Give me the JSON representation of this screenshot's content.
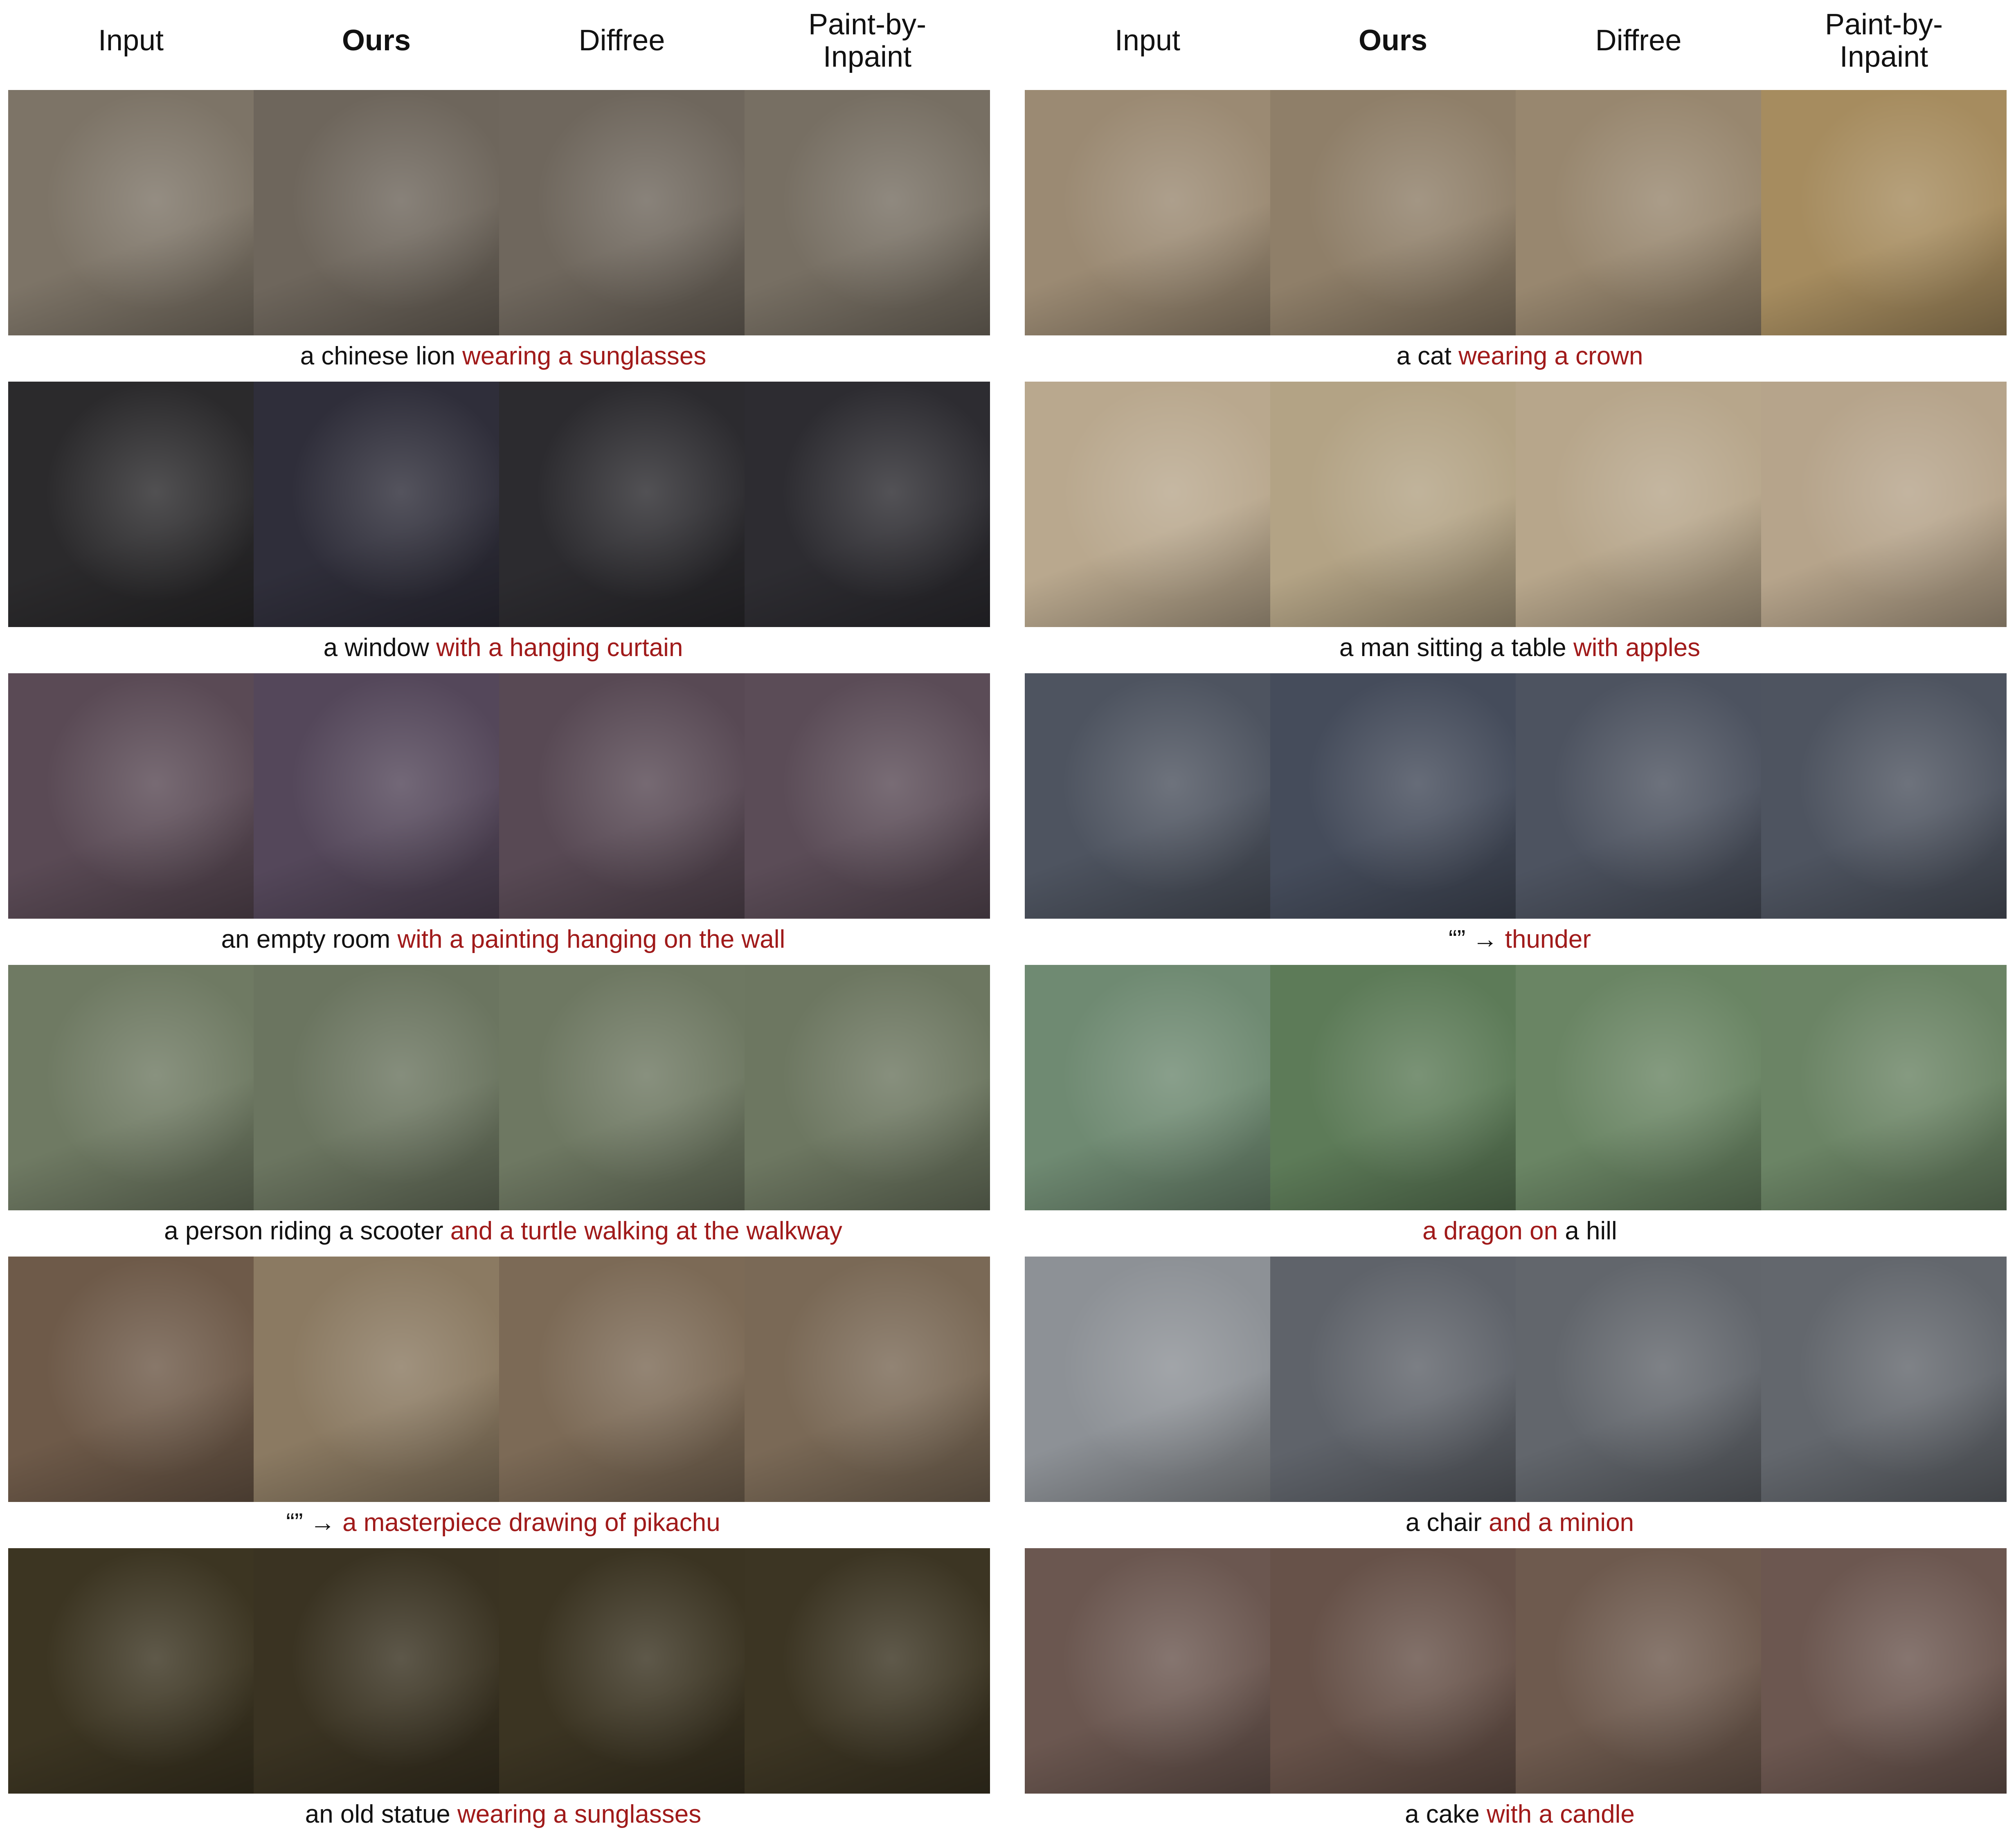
{
  "columns": {
    "left": [
      "Input",
      "Ours",
      "Diffree",
      "Paint-by-\nInpaint"
    ],
    "right": [
      "Input",
      "Ours",
      "Diffree",
      "Paint-by-\nInpaint"
    ]
  },
  "rows": [
    {
      "left": {
        "pre": "a chinese lion ",
        "hl": "wearing a sunglasses",
        "post": "",
        "colors": [
          "#7d7467",
          "#6e665c",
          "#6f675d",
          "#776f63"
        ]
      },
      "right": {
        "pre": "a cat ",
        "hl": "wearing a crown",
        "post": "",
        "colors": [
          "#9b8a73",
          "#8f7f69",
          "#98876f",
          "#a68c5f"
        ]
      }
    },
    {
      "left": {
        "pre": "a window ",
        "hl": "with a hanging curtain",
        "post": "",
        "colors": [
          "#2b2a2c",
          "#2f2e3a",
          "#2c2b2f",
          "#2d2c31"
        ]
      },
      "right": {
        "pre": "a man sitting a table ",
        "hl": "with apples",
        "post": "",
        "colors": [
          "#b9a88e",
          "#b3a385",
          "#b7a68b",
          "#b6a48b"
        ]
      }
    },
    {
      "left": {
        "pre": "an empty room ",
        "hl": "with a painting hanging on the wall",
        "post": "",
        "colors": [
          "#5a4a55",
          "#54475a",
          "#584954",
          "#5b4c57"
        ]
      },
      "right": {
        "pre": "“” → ",
        "hl": "thunder",
        "post": "",
        "colors": [
          "#4e5460",
          "#454c5b",
          "#4d5360",
          "#4e5460"
        ]
      }
    },
    {
      "left": {
        "pre": "a person riding a scooter ",
        "hl": "and a turtle walking at the walkway",
        "post": "",
        "colors": [
          "#6f7a63",
          "#6b7560",
          "#6e7862",
          "#6d7761"
        ]
      },
      "right": {
        "pre": "",
        "hl": "a dragon on",
        "post": " a hill",
        "colors": [
          "#6f8a72",
          "#5d7b58",
          "#6a8564",
          "#6b8465"
        ]
      }
    },
    {
      "left": {
        "pre": "“” → ",
        "hl": "a masterpiece drawing of pikachu",
        "post": "",
        "colors": [
          "#6e5a49",
          "#8b7a62",
          "#7c6a56",
          "#7a6956"
        ]
      },
      "right": {
        "pre": "a chair ",
        "hl": "and a minion",
        "post": "",
        "colors": [
          "#8d9196",
          "#5f636a",
          "#62666c",
          "#63676d"
        ]
      }
    },
    {
      "left": {
        "pre": "an old statue ",
        "hl": "wearing a sunglasses",
        "post": "",
        "colors": [
          "#3c3522",
          "#3a3322",
          "#3b3422",
          "#3c3523"
        ]
      },
      "right": {
        "pre": "a cake ",
        "hl": "with a candle",
        "post": "",
        "colors": [
          "#6b5750",
          "#675249",
          "#6e5a4e",
          "#6c5750"
        ]
      }
    }
  ]
}
